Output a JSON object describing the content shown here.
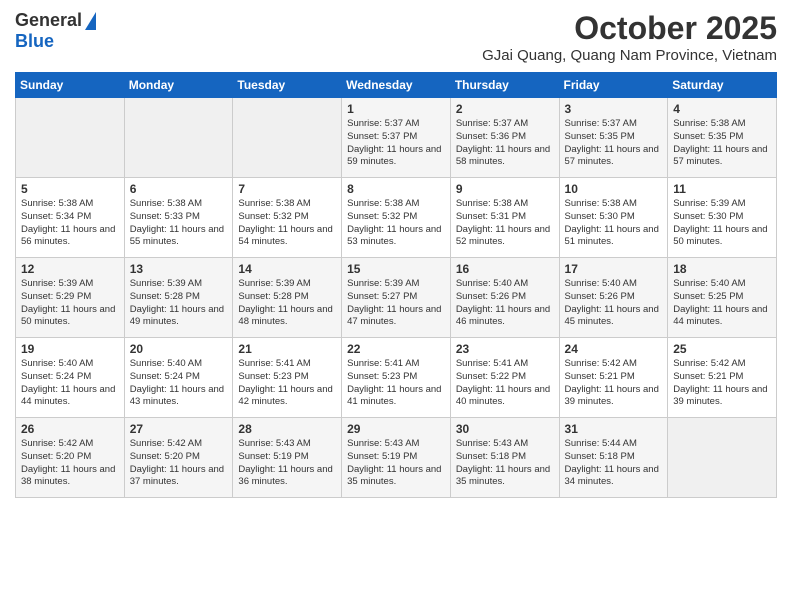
{
  "logo": {
    "general": "General",
    "blue": "Blue"
  },
  "header": {
    "month": "October 2025",
    "location": "GJai Quang, Quang Nam Province, Vietnam"
  },
  "weekdays": [
    "Sunday",
    "Monday",
    "Tuesday",
    "Wednesday",
    "Thursday",
    "Friday",
    "Saturday"
  ],
  "weeks": [
    [
      {
        "day": "",
        "sunrise": "",
        "sunset": "",
        "daylight": "",
        "empty": true
      },
      {
        "day": "",
        "sunrise": "",
        "sunset": "",
        "daylight": "",
        "empty": true
      },
      {
        "day": "",
        "sunrise": "",
        "sunset": "",
        "daylight": "",
        "empty": true
      },
      {
        "day": "1",
        "sunrise": "Sunrise: 5:37 AM",
        "sunset": "Sunset: 5:37 PM",
        "daylight": "Daylight: 11 hours and 59 minutes."
      },
      {
        "day": "2",
        "sunrise": "Sunrise: 5:37 AM",
        "sunset": "Sunset: 5:36 PM",
        "daylight": "Daylight: 11 hours and 58 minutes."
      },
      {
        "day": "3",
        "sunrise": "Sunrise: 5:37 AM",
        "sunset": "Sunset: 5:35 PM",
        "daylight": "Daylight: 11 hours and 57 minutes."
      },
      {
        "day": "4",
        "sunrise": "Sunrise: 5:38 AM",
        "sunset": "Sunset: 5:35 PM",
        "daylight": "Daylight: 11 hours and 57 minutes."
      }
    ],
    [
      {
        "day": "5",
        "sunrise": "Sunrise: 5:38 AM",
        "sunset": "Sunset: 5:34 PM",
        "daylight": "Daylight: 11 hours and 56 minutes."
      },
      {
        "day": "6",
        "sunrise": "Sunrise: 5:38 AM",
        "sunset": "Sunset: 5:33 PM",
        "daylight": "Daylight: 11 hours and 55 minutes."
      },
      {
        "day": "7",
        "sunrise": "Sunrise: 5:38 AM",
        "sunset": "Sunset: 5:32 PM",
        "daylight": "Daylight: 11 hours and 54 minutes."
      },
      {
        "day": "8",
        "sunrise": "Sunrise: 5:38 AM",
        "sunset": "Sunset: 5:32 PM",
        "daylight": "Daylight: 11 hours and 53 minutes."
      },
      {
        "day": "9",
        "sunrise": "Sunrise: 5:38 AM",
        "sunset": "Sunset: 5:31 PM",
        "daylight": "Daylight: 11 hours and 52 minutes."
      },
      {
        "day": "10",
        "sunrise": "Sunrise: 5:38 AM",
        "sunset": "Sunset: 5:30 PM",
        "daylight": "Daylight: 11 hours and 51 minutes."
      },
      {
        "day": "11",
        "sunrise": "Sunrise: 5:39 AM",
        "sunset": "Sunset: 5:30 PM",
        "daylight": "Daylight: 11 hours and 50 minutes."
      }
    ],
    [
      {
        "day": "12",
        "sunrise": "Sunrise: 5:39 AM",
        "sunset": "Sunset: 5:29 PM",
        "daylight": "Daylight: 11 hours and 50 minutes."
      },
      {
        "day": "13",
        "sunrise": "Sunrise: 5:39 AM",
        "sunset": "Sunset: 5:28 PM",
        "daylight": "Daylight: 11 hours and 49 minutes."
      },
      {
        "day": "14",
        "sunrise": "Sunrise: 5:39 AM",
        "sunset": "Sunset: 5:28 PM",
        "daylight": "Daylight: 11 hours and 48 minutes."
      },
      {
        "day": "15",
        "sunrise": "Sunrise: 5:39 AM",
        "sunset": "Sunset: 5:27 PM",
        "daylight": "Daylight: 11 hours and 47 minutes."
      },
      {
        "day": "16",
        "sunrise": "Sunrise: 5:40 AM",
        "sunset": "Sunset: 5:26 PM",
        "daylight": "Daylight: 11 hours and 46 minutes."
      },
      {
        "day": "17",
        "sunrise": "Sunrise: 5:40 AM",
        "sunset": "Sunset: 5:26 PM",
        "daylight": "Daylight: 11 hours and 45 minutes."
      },
      {
        "day": "18",
        "sunrise": "Sunrise: 5:40 AM",
        "sunset": "Sunset: 5:25 PM",
        "daylight": "Daylight: 11 hours and 44 minutes."
      }
    ],
    [
      {
        "day": "19",
        "sunrise": "Sunrise: 5:40 AM",
        "sunset": "Sunset: 5:24 PM",
        "daylight": "Daylight: 11 hours and 44 minutes."
      },
      {
        "day": "20",
        "sunrise": "Sunrise: 5:40 AM",
        "sunset": "Sunset: 5:24 PM",
        "daylight": "Daylight: 11 hours and 43 minutes."
      },
      {
        "day": "21",
        "sunrise": "Sunrise: 5:41 AM",
        "sunset": "Sunset: 5:23 PM",
        "daylight": "Daylight: 11 hours and 42 minutes."
      },
      {
        "day": "22",
        "sunrise": "Sunrise: 5:41 AM",
        "sunset": "Sunset: 5:23 PM",
        "daylight": "Daylight: 11 hours and 41 minutes."
      },
      {
        "day": "23",
        "sunrise": "Sunrise: 5:41 AM",
        "sunset": "Sunset: 5:22 PM",
        "daylight": "Daylight: 11 hours and 40 minutes."
      },
      {
        "day": "24",
        "sunrise": "Sunrise: 5:42 AM",
        "sunset": "Sunset: 5:21 PM",
        "daylight": "Daylight: 11 hours and 39 minutes."
      },
      {
        "day": "25",
        "sunrise": "Sunrise: 5:42 AM",
        "sunset": "Sunset: 5:21 PM",
        "daylight": "Daylight: 11 hours and 39 minutes."
      }
    ],
    [
      {
        "day": "26",
        "sunrise": "Sunrise: 5:42 AM",
        "sunset": "Sunset: 5:20 PM",
        "daylight": "Daylight: 11 hours and 38 minutes."
      },
      {
        "day": "27",
        "sunrise": "Sunrise: 5:42 AM",
        "sunset": "Sunset: 5:20 PM",
        "daylight": "Daylight: 11 hours and 37 minutes."
      },
      {
        "day": "28",
        "sunrise": "Sunrise: 5:43 AM",
        "sunset": "Sunset: 5:19 PM",
        "daylight": "Daylight: 11 hours and 36 minutes."
      },
      {
        "day": "29",
        "sunrise": "Sunrise: 5:43 AM",
        "sunset": "Sunset: 5:19 PM",
        "daylight": "Daylight: 11 hours and 35 minutes."
      },
      {
        "day": "30",
        "sunrise": "Sunrise: 5:43 AM",
        "sunset": "Sunset: 5:18 PM",
        "daylight": "Daylight: 11 hours and 35 minutes."
      },
      {
        "day": "31",
        "sunrise": "Sunrise: 5:44 AM",
        "sunset": "Sunset: 5:18 PM",
        "daylight": "Daylight: 11 hours and 34 minutes."
      },
      {
        "day": "",
        "sunrise": "",
        "sunset": "",
        "daylight": "",
        "empty": true
      }
    ]
  ]
}
